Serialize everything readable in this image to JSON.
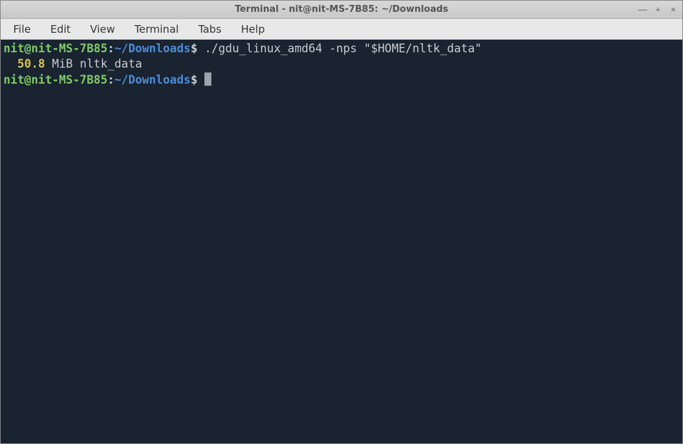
{
  "window": {
    "title": "Terminal - nit@nit-MS-7B85: ~/Downloads"
  },
  "menubar": {
    "items": [
      "File",
      "Edit",
      "View",
      "Terminal",
      "Tabs",
      "Help"
    ]
  },
  "prompt": {
    "user_host": "nit@nit-MS-7B85",
    "colon": ":",
    "path": "~/Downloads",
    "symbol": "$"
  },
  "lines": {
    "cmd1": " ./gdu_linux_amd64 -nps \"$HOME/nltk_data\"",
    "out_size": "  50.8",
    "out_rest": " MiB nltk_data",
    "cmd2": " "
  }
}
